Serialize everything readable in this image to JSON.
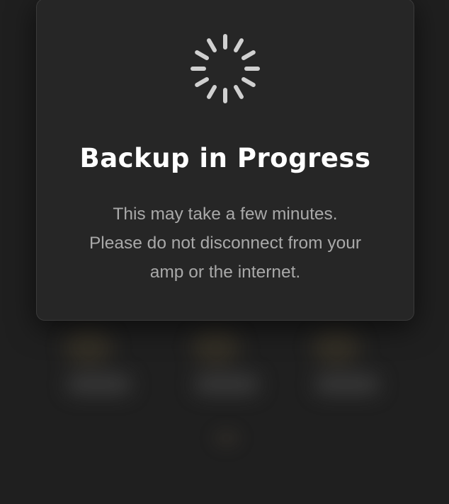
{
  "modal": {
    "title": "Backup in Progress",
    "message_lines": [
      "This may take a few minutes.",
      "Please do not disconnect from your",
      "amp or the internet."
    ]
  },
  "spinner": {
    "icon": "loading-spinner-icon",
    "color": "#d0d0d0"
  },
  "colors": {
    "background": "#1f1f1f",
    "modal_background": "#262626",
    "title_text": "#ffffff",
    "body_text": "#a9a9a9"
  }
}
